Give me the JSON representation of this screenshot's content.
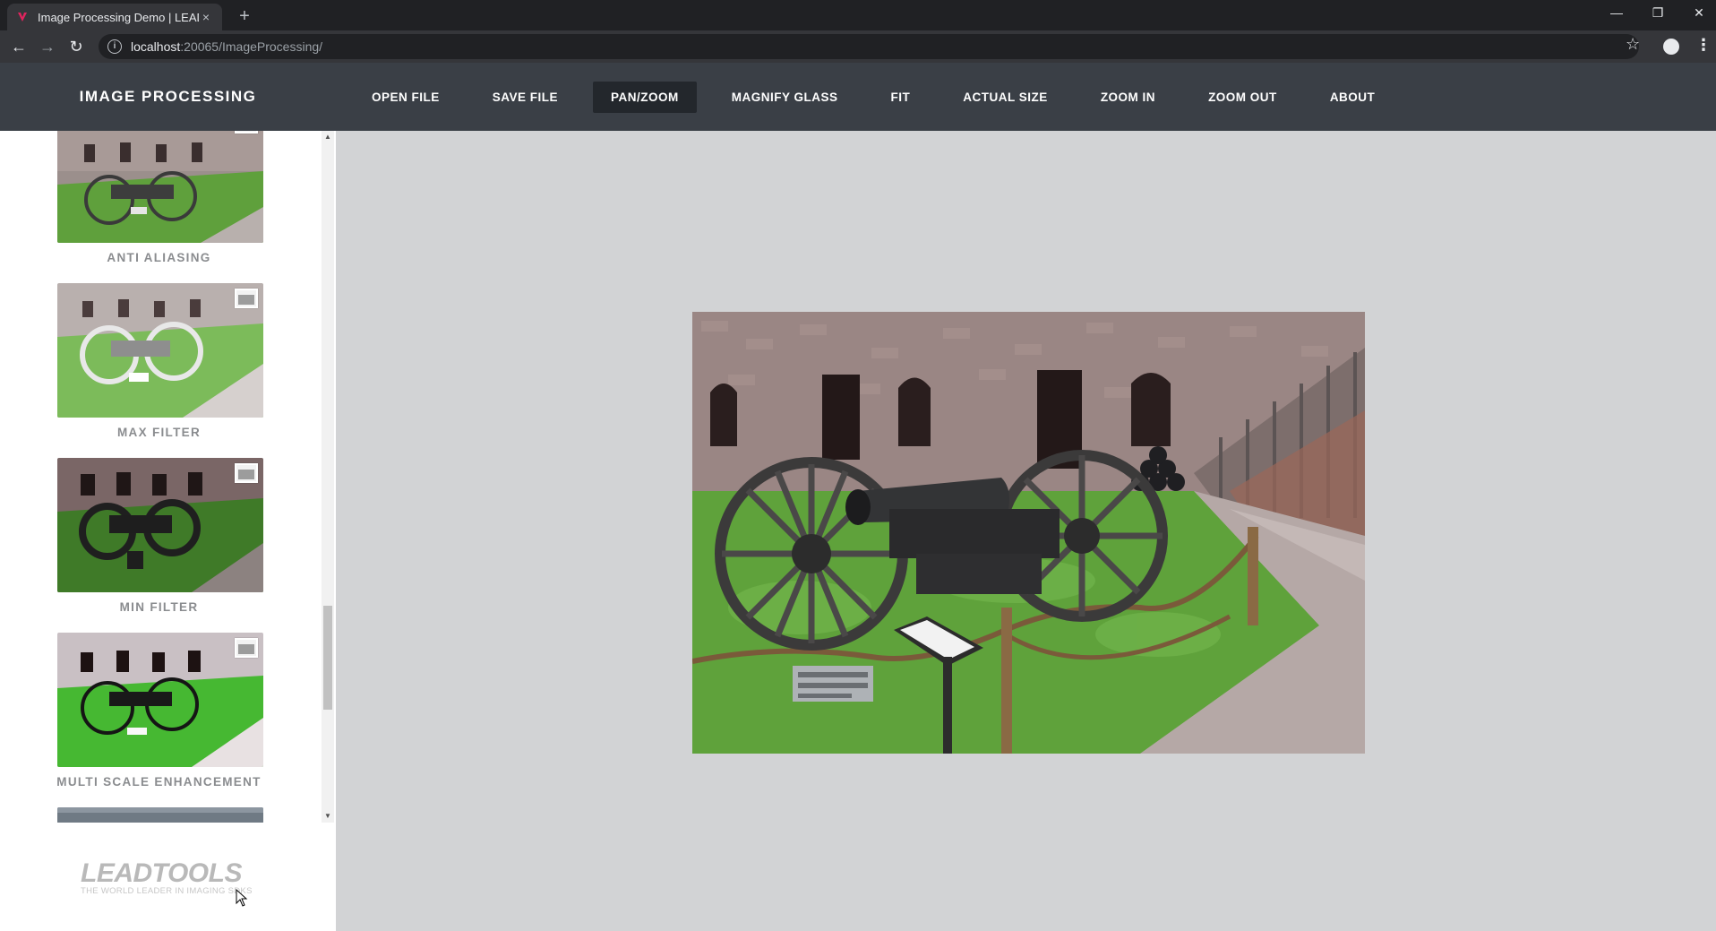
{
  "browser": {
    "tab_title": "Image Processing Demo | LEADTO",
    "tab_close": "×",
    "new_tab": "+",
    "url_host": "localhost",
    "url_path": ":20065/ImageProcessing/",
    "win_min": "—",
    "win_restore": "❐",
    "win_close": "✕"
  },
  "app": {
    "brand": "IMAGE PROCESSING",
    "nav": [
      {
        "label": "OPEN FILE"
      },
      {
        "label": "SAVE FILE"
      },
      {
        "label": "PAN/ZOOM",
        "active": true
      },
      {
        "label": "MAGNIFY GLASS"
      },
      {
        "label": "FIT"
      },
      {
        "label": "ACTUAL SIZE"
      },
      {
        "label": "ZOOM IN"
      },
      {
        "label": "ZOOM OUT"
      },
      {
        "label": "ABOUT"
      }
    ]
  },
  "sidebar": {
    "items": [
      {
        "label": "ANTI ALIASING"
      },
      {
        "label": "MAX FILTER"
      },
      {
        "label": "MIN FILTER"
      },
      {
        "label": "MULTI SCALE ENHANCEMENT"
      }
    ],
    "logo": "LEADTOOLS",
    "logo_tagline": "THE WORLD LEADER IN IMAGING SDKS"
  },
  "colors": {
    "header_bg": "#3a3f46",
    "active_nav_bg": "#23272c",
    "viewer_bg": "#d2d3d5"
  }
}
